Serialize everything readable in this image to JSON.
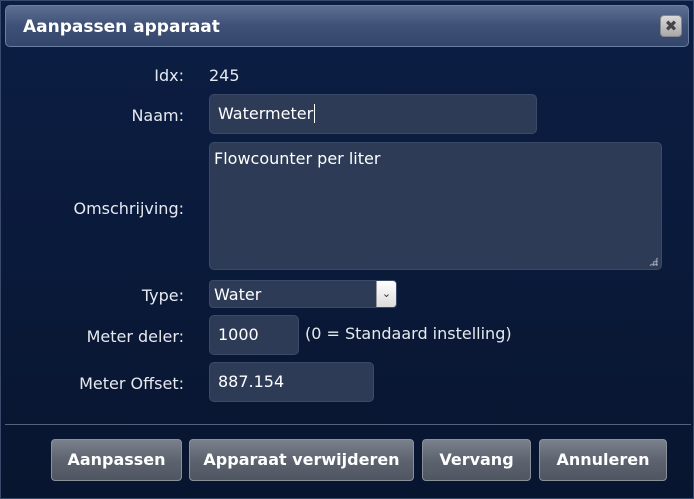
{
  "dialog": {
    "title": "Aanpassen apparaat",
    "close_icon": "close-icon"
  },
  "form": {
    "idx_label": "Idx:",
    "idx_value": "245",
    "name_label": "Naam:",
    "name_value": "Watermeter",
    "description_label": "Omschrijving:",
    "description_value": "Flowcounter per liter",
    "type_label": "Type:",
    "type_value": "Water",
    "divider_label": "Meter deler:",
    "divider_value": "1000",
    "divider_hint": "(0 = Standaard instelling)",
    "offset_label": "Meter Offset:",
    "offset_value": "887.154"
  },
  "buttons": {
    "update": "Aanpassen",
    "delete": "Apparaat verwijderen",
    "replace": "Vervang",
    "cancel": "Annuleren"
  }
}
